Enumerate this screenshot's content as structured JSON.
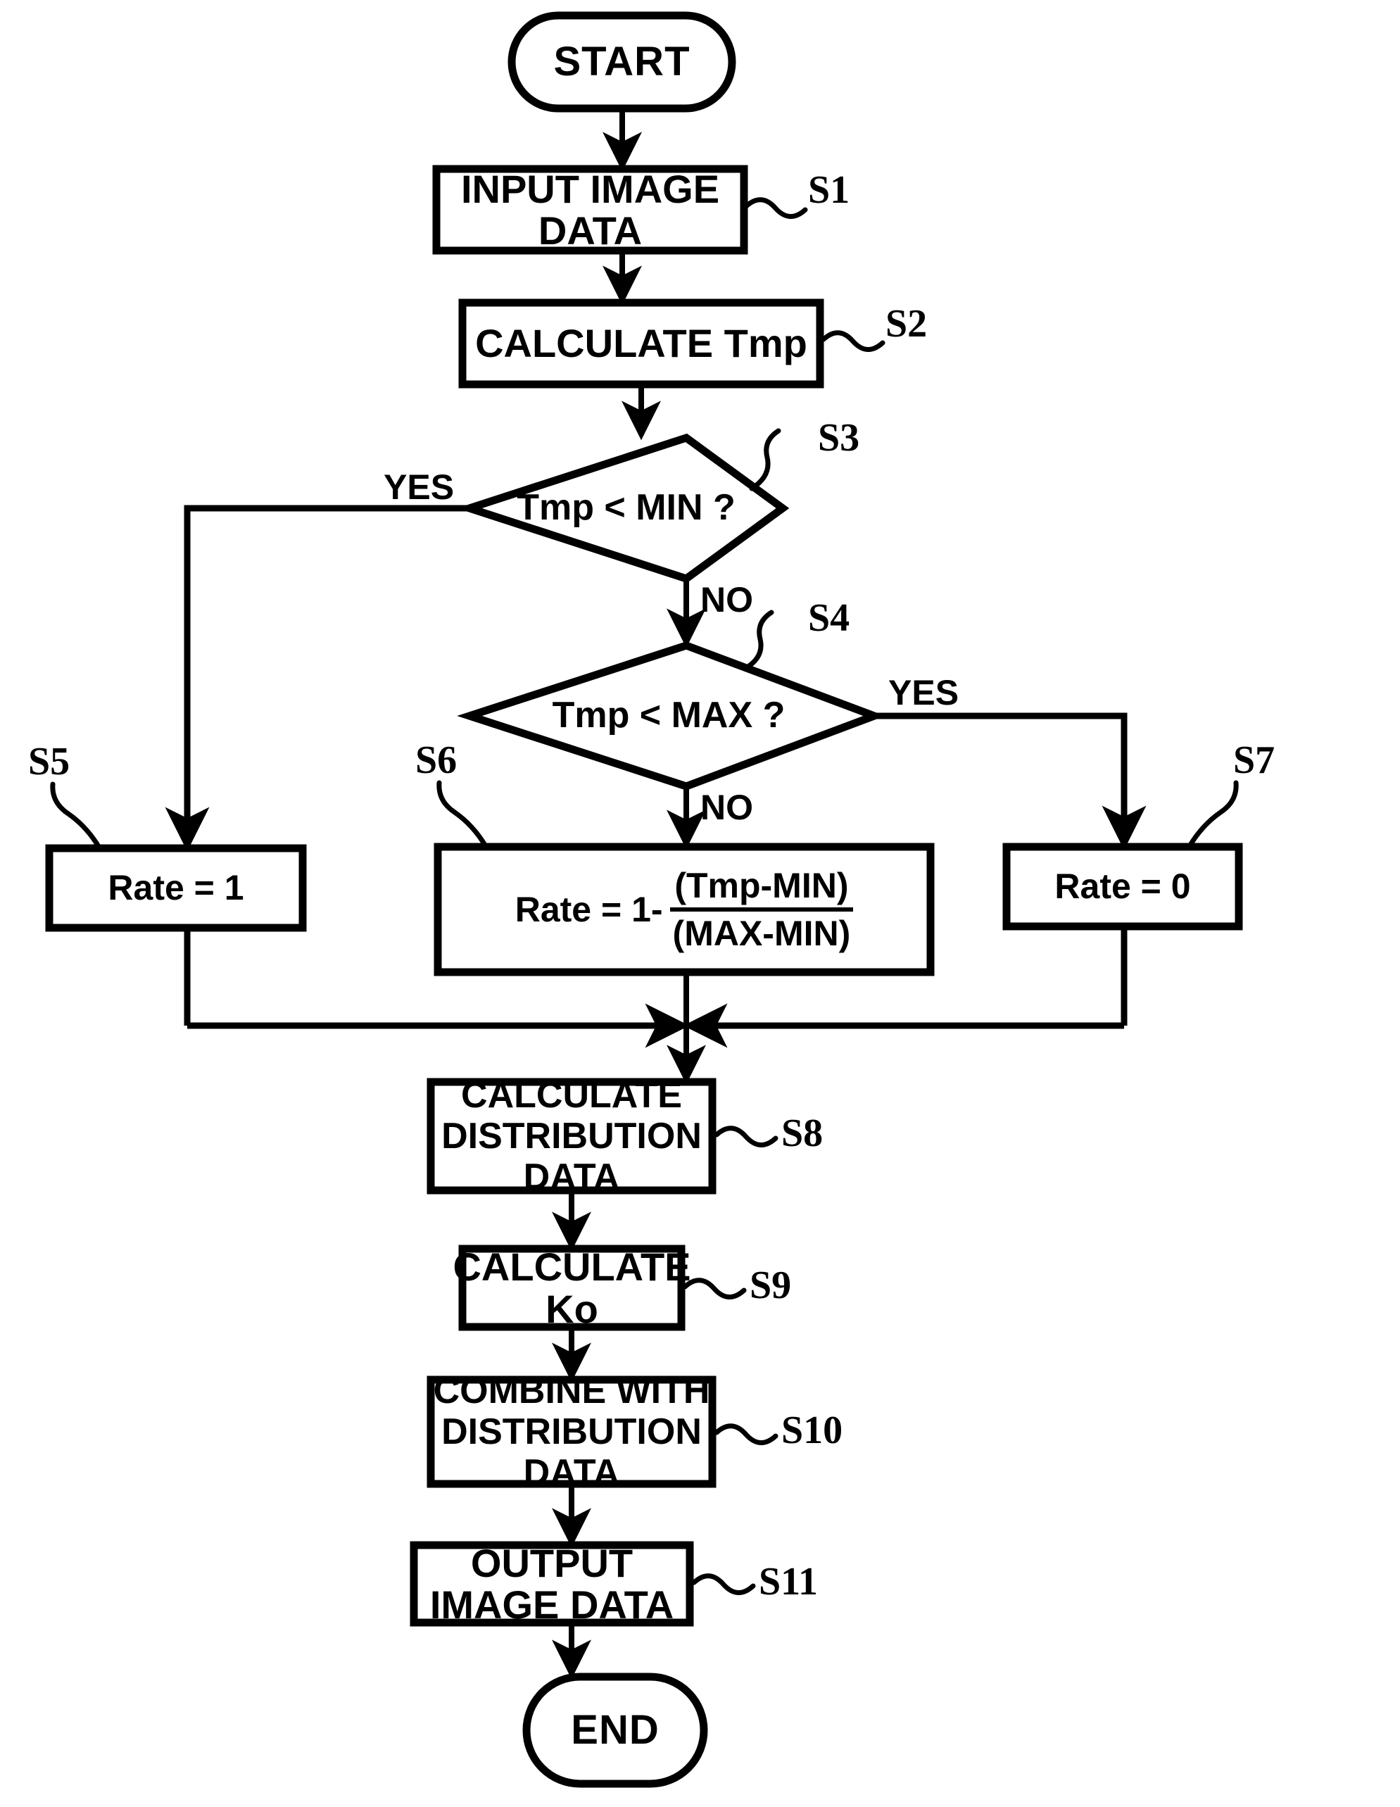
{
  "diagram": {
    "title": "Image processing rate calculation flowchart",
    "stroke_color": "#000000",
    "background_color": "#ffffff",
    "nodes": {
      "start": {
        "label": "START",
        "shape": "terminator",
        "ref": ""
      },
      "s1": {
        "label": "INPUT IMAGE DATA",
        "shape": "process",
        "ref": "S1"
      },
      "s2": {
        "label": "CALCULATE Tmp",
        "shape": "process",
        "ref": "S2"
      },
      "s3": {
        "label": "Tmp < MIN ?",
        "shape": "decision",
        "ref": "S3"
      },
      "s4": {
        "label": "Tmp < MAX ?",
        "shape": "decision",
        "ref": "S4"
      },
      "s5": {
        "label": "Rate = 1",
        "shape": "process",
        "ref": "S5"
      },
      "s6": {
        "label": "Rate = 1- (Tmp-MIN)/(MAX-MIN)",
        "shape": "process",
        "ref": "S6",
        "formula": {
          "lhs": "Rate = 1-",
          "numerator": "(Tmp-MIN)",
          "denominator": "(MAX-MIN)"
        }
      },
      "s7": {
        "label": "Rate = 0",
        "shape": "process",
        "ref": "S7"
      },
      "s8": {
        "label": "CALCULATE\nDISTRIBUTION DATA",
        "shape": "process",
        "ref": "S8"
      },
      "s9": {
        "label": "CALCULATE Ko",
        "shape": "process",
        "ref": "S9"
      },
      "s10": {
        "label": "COMBINE WITH\nDISTRIBUTION DATA",
        "shape": "process",
        "ref": "S10"
      },
      "s11": {
        "label": "OUTPUT IMAGE DATA",
        "shape": "process",
        "ref": "S11"
      },
      "end": {
        "label": "END",
        "shape": "terminator",
        "ref": ""
      }
    },
    "edge_labels": {
      "s3_yes": "YES",
      "s3_no": "NO",
      "s4_yes": "YES",
      "s4_no": "NO"
    }
  },
  "chart_data": {
    "type": "diagram",
    "subtype": "flowchart",
    "title": "Image processing rate calculation flowchart",
    "nodes": [
      {
        "id": "start",
        "ref": "",
        "text": "START",
        "shape": "terminator"
      },
      {
        "id": "s1",
        "ref": "S1",
        "text": "INPUT IMAGE DATA",
        "shape": "process"
      },
      {
        "id": "s2",
        "ref": "S2",
        "text": "CALCULATE Tmp",
        "shape": "process"
      },
      {
        "id": "s3",
        "ref": "S3",
        "text": "Tmp < MIN ?",
        "shape": "decision"
      },
      {
        "id": "s4",
        "ref": "S4",
        "text": "Tmp < MAX ?",
        "shape": "decision"
      },
      {
        "id": "s5",
        "ref": "S5",
        "text": "Rate = 1",
        "shape": "process"
      },
      {
        "id": "s6",
        "ref": "S6",
        "text": "Rate = 1- (Tmp-MIN)/(MAX-MIN)",
        "shape": "process"
      },
      {
        "id": "s7",
        "ref": "S7",
        "text": "Rate = 0",
        "shape": "process"
      },
      {
        "id": "s8",
        "ref": "S8",
        "text": "CALCULATE DISTRIBUTION DATA",
        "shape": "process"
      },
      {
        "id": "s9",
        "ref": "S9",
        "text": "CALCULATE Ko",
        "shape": "process"
      },
      {
        "id": "s10",
        "ref": "S10",
        "text": "COMBINE WITH DISTRIBUTION DATA",
        "shape": "process"
      },
      {
        "id": "s11",
        "ref": "S11",
        "text": "OUTPUT IMAGE DATA",
        "shape": "process"
      },
      {
        "id": "end",
        "ref": "",
        "text": "END",
        "shape": "terminator"
      }
    ],
    "edges": [
      {
        "from": "start",
        "to": "s1",
        "label": ""
      },
      {
        "from": "s1",
        "to": "s2",
        "label": ""
      },
      {
        "from": "s2",
        "to": "s3",
        "label": ""
      },
      {
        "from": "s3",
        "to": "s5",
        "label": "YES"
      },
      {
        "from": "s3",
        "to": "s4",
        "label": "NO"
      },
      {
        "from": "s4",
        "to": "s7",
        "label": "YES"
      },
      {
        "from": "s4",
        "to": "s6",
        "label": "NO"
      },
      {
        "from": "s5",
        "to": "s8",
        "label": ""
      },
      {
        "from": "s6",
        "to": "s8",
        "label": ""
      },
      {
        "from": "s7",
        "to": "s8",
        "label": ""
      },
      {
        "from": "s8",
        "to": "s9",
        "label": ""
      },
      {
        "from": "s9",
        "to": "s10",
        "label": ""
      },
      {
        "from": "s10",
        "to": "s11",
        "label": ""
      },
      {
        "from": "s11",
        "to": "end",
        "label": ""
      }
    ]
  }
}
